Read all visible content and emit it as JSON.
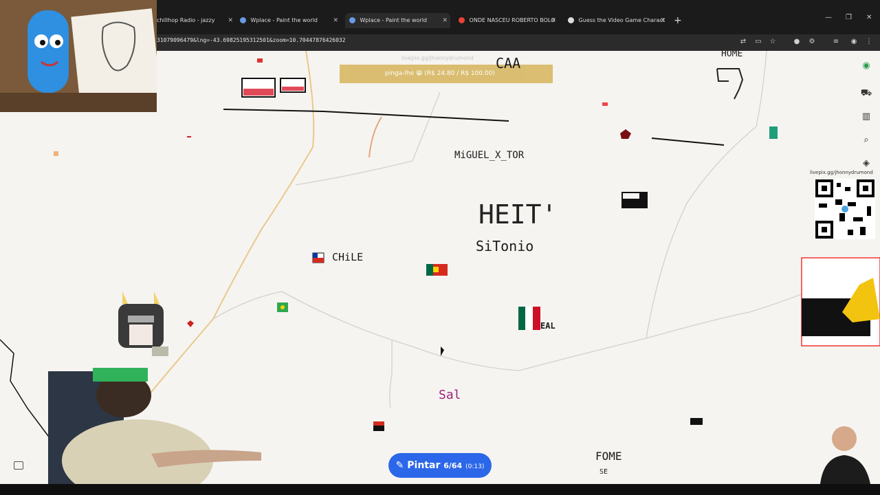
{
  "tabs": [
    {
      "label": "chillhop Radio - jazzy",
      "active": false
    },
    {
      "label": "Wplace - Paint the world",
      "active": false
    },
    {
      "label": "Wplace - Paint the world",
      "active": true
    },
    {
      "label": "ONDE NASCEU ROBERTO BOLO",
      "active": false
    },
    {
      "label": "Guess the Video Game Charact",
      "active": false
    }
  ],
  "address": {
    "url": "31079096479&lng=-43.69825195312501&zoom=10.70447876426032"
  },
  "banner": {
    "text": "pinga-lhe 😁 (R$ 24.80 / R$ 100.00)",
    "small": "livepix.gg/jhonnydrumond"
  },
  "map_labels": {
    "caa": "CAA",
    "home": "HOME",
    "miguel": "MiGUEL_X_TOR",
    "heit": "HEIT'",
    "sitonio": "SiTonio",
    "chile": "CHiLE",
    "real": "EAL",
    "sal": "Sal",
    "fome": "FOME",
    "se": "SE"
  },
  "paint_button": {
    "label": "Pintar",
    "count": "6/64",
    "timer": "(0:13)"
  },
  "qr": {
    "caption": "livepix.gg/jhonnydrumond"
  },
  "colors": {
    "accent": "#2b67e8",
    "chile_red": "#d52b1e",
    "mexico_green": "#006847"
  }
}
